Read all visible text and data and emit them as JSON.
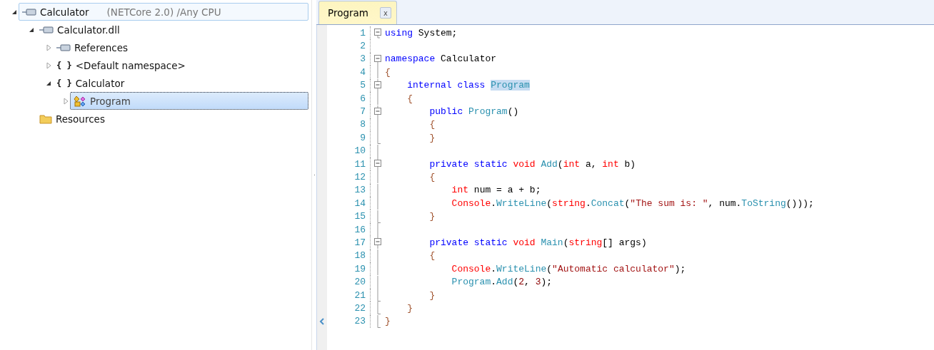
{
  "tree": [
    {
      "kind": "assembly",
      "label": "Calculator",
      "detail": "(NETCore 2.0) /Any CPU",
      "expanded": true,
      "selected": false,
      "hovered": true,
      "children": [
        {
          "kind": "assembly",
          "label": "Calculator.dll",
          "expanded": true,
          "selected": false,
          "children": [
            {
              "kind": "assembly",
              "label": "References",
              "expanded": false,
              "selected": false
            },
            {
              "kind": "namespace",
              "icon": "{ }",
              "label": "<Default namespace>",
              "expanded": false,
              "selected": false
            },
            {
              "kind": "namespace",
              "icon": "{ }",
              "label": "Calculator",
              "expanded": true,
              "selected": false,
              "children": [
                {
                  "kind": "class",
                  "label": "Program",
                  "expanded": false,
                  "selected": true
                }
              ]
            }
          ]
        },
        {
          "kind": "folder",
          "label": "Resources",
          "selected": false
        }
      ]
    }
  ],
  "tabs": [
    {
      "label": "Program",
      "close": "x",
      "selected": true
    }
  ],
  "code": [
    {
      "n": "1",
      "kind": "single",
      "tokens": [
        {
          "kind": "kw",
          "text": "using"
        },
        {
          "kind": "p",
          "text": " System;"
        }
      ]
    },
    {
      "n": "2",
      "kind": "none"
    },
    {
      "n": "3",
      "kind": "first",
      "tokens": [
        {
          "kind": "kw",
          "text": "namespace"
        },
        {
          "kind": "p",
          "text": " Calculator"
        }
      ]
    },
    {
      "n": "4",
      "kind": "inner",
      "tokens": [
        {
          "kind": "b",
          "text": "{"
        }
      ]
    },
    {
      "n": "5",
      "kind": "start",
      "tokens": [
        {
          "kind": "kw",
          "text": "    internal class "
        },
        {
          "kind": "hl",
          "text": "Program"
        }
      ]
    },
    {
      "n": "6",
      "kind": "inner",
      "tokens": [
        {
          "kind": "b",
          "text": "    {"
        }
      ]
    },
    {
      "n": "7",
      "kind": "start",
      "tokens": [
        {
          "kind": "kw",
          "text": "        public "
        },
        {
          "kind": "t",
          "text": "Program"
        },
        {
          "kind": "p",
          "text": "()"
        }
      ]
    },
    {
      "n": "8",
      "kind": "inner",
      "tokens": [
        {
          "kind": "b",
          "text": "        {"
        }
      ]
    },
    {
      "n": "9",
      "kind": "end",
      "tokens": [
        {
          "kind": "b",
          "text": "        }"
        }
      ]
    },
    {
      "n": "10",
      "kind": "inner"
    },
    {
      "n": "11",
      "kind": "start",
      "tokens": [
        {
          "kind": "kw",
          "text": "        private static "
        },
        {
          "kind": "r",
          "text": "void "
        },
        {
          "kind": "t",
          "text": "Add"
        },
        {
          "kind": "p",
          "text": "("
        },
        {
          "kind": "r",
          "text": "int"
        },
        {
          "kind": "p",
          "text": " a, "
        },
        {
          "kind": "r",
          "text": "int"
        },
        {
          "kind": "p",
          "text": " b)"
        }
      ]
    },
    {
      "n": "12",
      "kind": "inner",
      "tokens": [
        {
          "kind": "b",
          "text": "        {"
        }
      ]
    },
    {
      "n": "13",
      "kind": "inner",
      "tokens": [
        {
          "kind": "r",
          "text": "            int"
        },
        {
          "kind": "p",
          "text": " num = a + b;"
        }
      ]
    },
    {
      "n": "14",
      "kind": "inner",
      "tokens": [
        {
          "kind": "r",
          "text": "            Console"
        },
        {
          "kind": "p",
          "text": "."
        },
        {
          "kind": "t",
          "text": "WriteLine"
        },
        {
          "kind": "p",
          "text": "("
        },
        {
          "kind": "r",
          "text": "string"
        },
        {
          "kind": "p",
          "text": "."
        },
        {
          "kind": "t",
          "text": "Concat"
        },
        {
          "kind": "p",
          "text": "("
        },
        {
          "kind": "s",
          "text": "\"The sum is: \""
        },
        {
          "kind": "p",
          "text": ", num."
        },
        {
          "kind": "t",
          "text": "ToString"
        },
        {
          "kind": "p",
          "text": "()));"
        }
      ]
    },
    {
      "n": "15",
      "kind": "end",
      "tokens": [
        {
          "kind": "b",
          "text": "        }"
        }
      ]
    },
    {
      "n": "16",
      "kind": "inner"
    },
    {
      "n": "17",
      "kind": "start",
      "tokens": [
        {
          "kind": "kw",
          "text": "        private static "
        },
        {
          "kind": "r",
          "text": "void "
        },
        {
          "kind": "t",
          "text": "Main"
        },
        {
          "kind": "p",
          "text": "("
        },
        {
          "kind": "r",
          "text": "string"
        },
        {
          "kind": "p",
          "text": "[] args)"
        }
      ]
    },
    {
      "n": "18",
      "kind": "inner",
      "tokens": [
        {
          "kind": "b",
          "text": "        {"
        }
      ]
    },
    {
      "n": "19",
      "kind": "inner",
      "tokens": [
        {
          "kind": "r",
          "text": "            Console"
        },
        {
          "kind": "p",
          "text": "."
        },
        {
          "kind": "t",
          "text": "WriteLine"
        },
        {
          "kind": "p",
          "text": "("
        },
        {
          "kind": "s",
          "text": "\"Automatic calculator\""
        },
        {
          "kind": "p",
          "text": ");"
        }
      ]
    },
    {
      "n": "20",
      "kind": "inner",
      "tokens": [
        {
          "kind": "t",
          "text": "            Program"
        },
        {
          "kind": "p",
          "text": "."
        },
        {
          "kind": "t",
          "text": "Add"
        },
        {
          "kind": "p",
          "text": "("
        },
        {
          "kind": "n",
          "text": "2"
        },
        {
          "kind": "p",
          "text": ", "
        },
        {
          "kind": "n",
          "text": "3"
        },
        {
          "kind": "p",
          "text": ");"
        }
      ]
    },
    {
      "n": "21",
      "kind": "end",
      "tokens": [
        {
          "kind": "b",
          "text": "        }"
        }
      ]
    },
    {
      "n": "22",
      "kind": "end",
      "tokens": [
        {
          "kind": "b",
          "text": "    }"
        }
      ]
    },
    {
      "n": "23",
      "kind": "end",
      "tokens": [
        {
          "kind": "b",
          "text": "}"
        }
      ]
    }
  ]
}
